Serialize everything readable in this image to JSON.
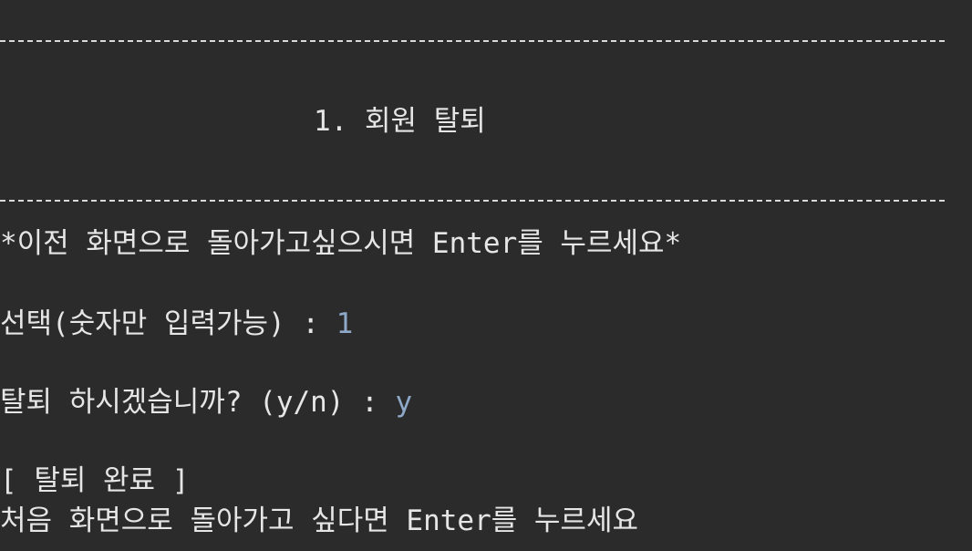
{
  "console": {
    "menu_title": "1. 회원 탈퇴",
    "back_hint": "*이전 화면으로 돌아가고싶으시면 Enter를 누르세요*",
    "select_prompt": "선택(숫자만 입력가능) : ",
    "select_value": "1",
    "confirm_prompt": "탈퇴 하시겠습니까? (y/n) : ",
    "confirm_value": "y",
    "result_message": "[ 탈퇴 완료 ]",
    "return_hint": "처음 화면으로 돌아가고 싶다면 Enter를 누르세요"
  },
  "colors": {
    "background": "#2b2b2b",
    "text": "#e6e6e6",
    "user_input": "#8fa9c9"
  }
}
